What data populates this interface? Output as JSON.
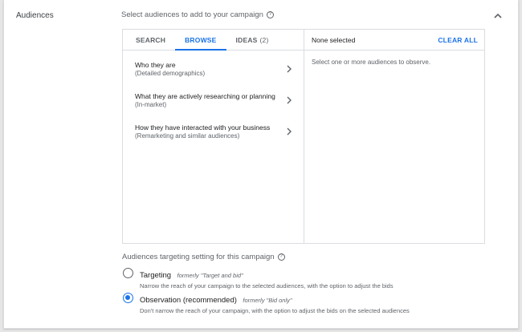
{
  "section": {
    "title": "Audiences",
    "description": "Select audiences to add to your campaign",
    "help_icon": "?"
  },
  "tabs": [
    {
      "label": "SEARCH"
    },
    {
      "label": "BROWSE",
      "active": true
    },
    {
      "label": "IDEAS",
      "count": "(2)"
    }
  ],
  "browse_items": [
    {
      "title": "Who they are",
      "subtitle": "(Detailed demographics)"
    },
    {
      "title": "What they are actively researching or planning",
      "subtitle": "(In-market)"
    },
    {
      "title": "How they have interacted with your business",
      "subtitle": "(Remarketing and similar audiences)"
    }
  ],
  "selection": {
    "status": "None selected",
    "clear_label": "CLEAR ALL",
    "hint": "Select one or more audiences to observe."
  },
  "targeting_setting": {
    "title": "Audiences targeting setting for this campaign",
    "help_icon": "?",
    "options": [
      {
        "label": "Targeting",
        "formerly": "formerly \"Target and bid\"",
        "description": "Narrow the reach of your campaign to the selected audiences, with the option to adjust the bids",
        "checked": false
      },
      {
        "label": "Observation (recommended)",
        "formerly": "formerly \"Bid only\"",
        "description": "Don't narrow the reach of your campaign, with the option to adjust the bids on the selected audiences",
        "checked": true
      }
    ]
  },
  "colors": {
    "accent": "#1a73e8",
    "text_primary": "#202124",
    "text_secondary": "#5f6368",
    "border": "#dadce0",
    "background": "#e6e6e6"
  },
  "icons": {
    "collapse": "chevron-up-icon",
    "item_chevron": "chevron-right-icon",
    "help": "help-circle-icon"
  }
}
